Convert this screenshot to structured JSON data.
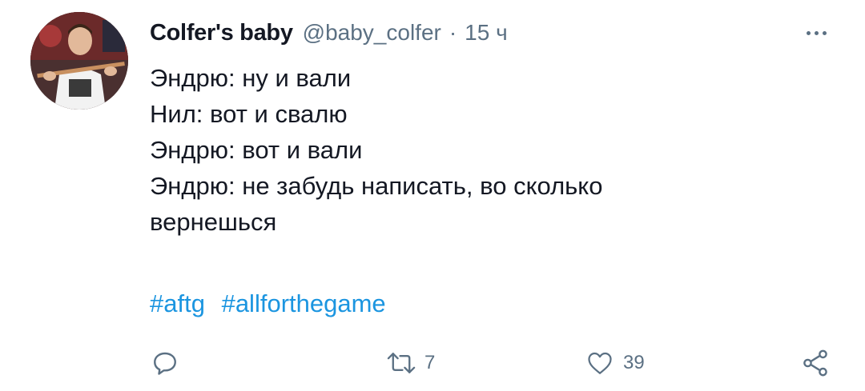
{
  "tweet": {
    "display_name": "Colfer's baby",
    "handle": "@baby_colfer",
    "separator": "·",
    "time": "15 ч",
    "lines": [
      "Эндрю: ну и вали",
      "Нил: вот и свалю",
      "Эндрю: вот и вали",
      "Эндрю: не забудь написать, во сколько",
      "вернешься"
    ],
    "hashtags": [
      "#aftg",
      "#allforthegame"
    ]
  },
  "actions": {
    "reply_icon": "reply-icon",
    "retweet_icon": "retweet-icon",
    "retweet_count": "7",
    "like_icon": "heart-icon",
    "like_count": "39",
    "share_icon": "share-icon"
  },
  "colors": {
    "text": "#141823",
    "secondary": "#5b7083",
    "hashtag": "#1b95e0"
  }
}
